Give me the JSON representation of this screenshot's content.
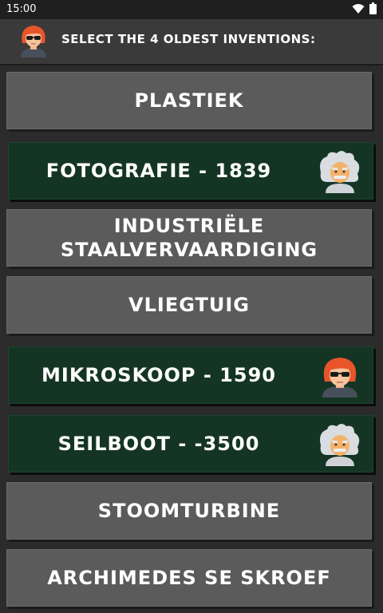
{
  "status": {
    "time": "15:00"
  },
  "header": {
    "title": "Select the 4 oldest inventions:"
  },
  "options": [
    {
      "label": "Plastiek",
      "state": "neutral"
    },
    {
      "label": "Fotografie - 1839",
      "state": "correct",
      "player": "einstein"
    },
    {
      "label": "Industriële staalvervaardiging",
      "state": "neutral"
    },
    {
      "label": "Vliegtuig",
      "state": "neutral"
    },
    {
      "label": "Mikroskoop - 1590",
      "state": "correct",
      "player": "redhead"
    },
    {
      "label": "Seilboot - -3500",
      "state": "correct",
      "player": "einstein"
    },
    {
      "label": "Stoomturbine",
      "state": "neutral"
    },
    {
      "label": "Archimedes se skroef",
      "state": "neutral"
    }
  ],
  "colors": {
    "neutral": "#5b5b5b",
    "correct": "#153524",
    "header": "#3a3a3a"
  }
}
